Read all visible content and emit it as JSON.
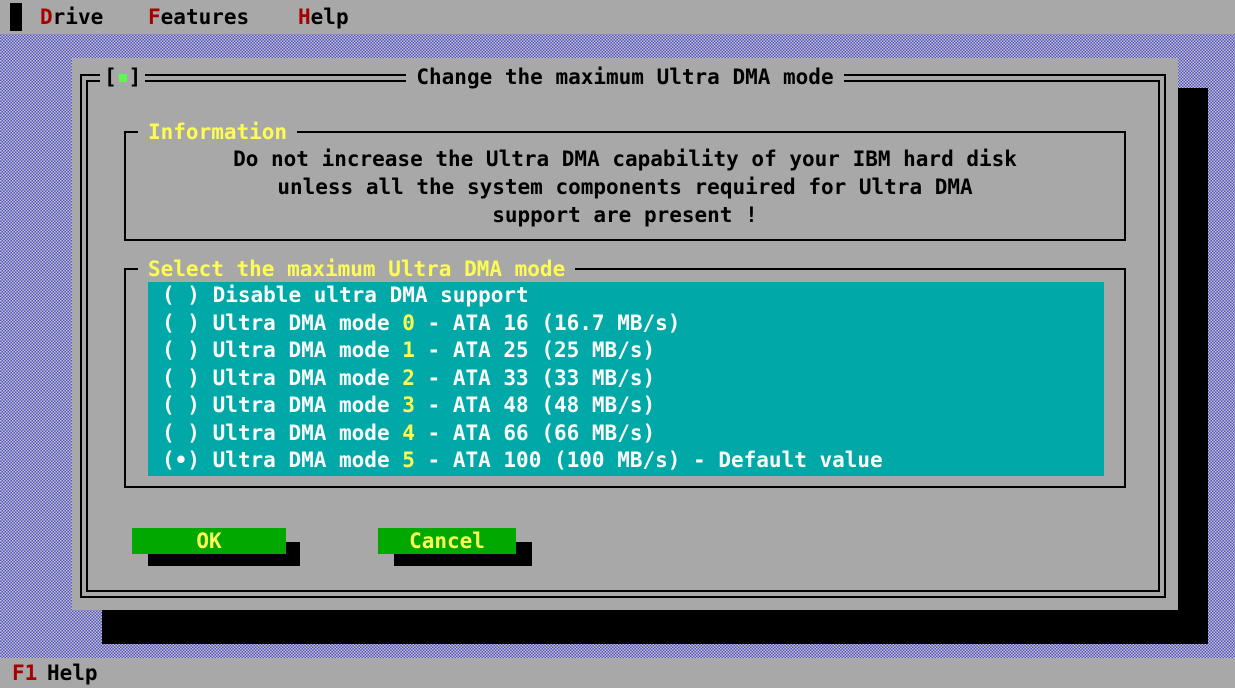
{
  "menubar": {
    "items": [
      {
        "hotkey": "D",
        "rest": "rive"
      },
      {
        "hotkey": "F",
        "rest": "eatures"
      },
      {
        "hotkey": "H",
        "rest": "elp"
      }
    ]
  },
  "dialog": {
    "close_label": "[",
    "close_label_end": "]",
    "title": "Change the maximum Ultra DMA mode",
    "info": {
      "label": "Information",
      "line1": "Do not increase the Ultra DMA capability of your IBM hard disk",
      "line2": "unless all the system components required for Ultra DMA",
      "line3": "support are present !"
    },
    "select": {
      "label": "Select the maximum Ultra DMA mode",
      "options": [
        {
          "radio": "( )",
          "prefix": "Disable ultra DMA support",
          "num": "",
          "suffix": ""
        },
        {
          "radio": "( )",
          "prefix": "Ultra DMA mode ",
          "num": "0",
          "suffix": " - ATA 16 (16.7 MB/s)"
        },
        {
          "radio": "( )",
          "prefix": "Ultra DMA mode ",
          "num": "1",
          "suffix": " - ATA 25 (25 MB/s)"
        },
        {
          "radio": "( )",
          "prefix": "Ultra DMA mode ",
          "num": "2",
          "suffix": " - ATA 33 (33 MB/s)"
        },
        {
          "radio": "( )",
          "prefix": "Ultra DMA mode ",
          "num": "3",
          "suffix": " - ATA 48 (48 MB/s)"
        },
        {
          "radio": "( )",
          "prefix": "Ultra DMA mode ",
          "num": "4",
          "suffix": " - ATA 66 (66 MB/s)"
        },
        {
          "radio": "(•)",
          "prefix": "Ultra DMA mode ",
          "num": "5",
          "suffix": " - ATA 100 (100 MB/s) - Default value"
        }
      ]
    },
    "ok_label": "OK",
    "cancel_label": "Cancel"
  },
  "statusbar": {
    "key": "F1",
    "label": "Help"
  },
  "colors": {
    "background": "#a8a8a8",
    "list_bg": "#00a8a8",
    "button_bg": "#00a800",
    "accent_yellow": "#fcfc54",
    "hotkey_red": "#a80000"
  }
}
